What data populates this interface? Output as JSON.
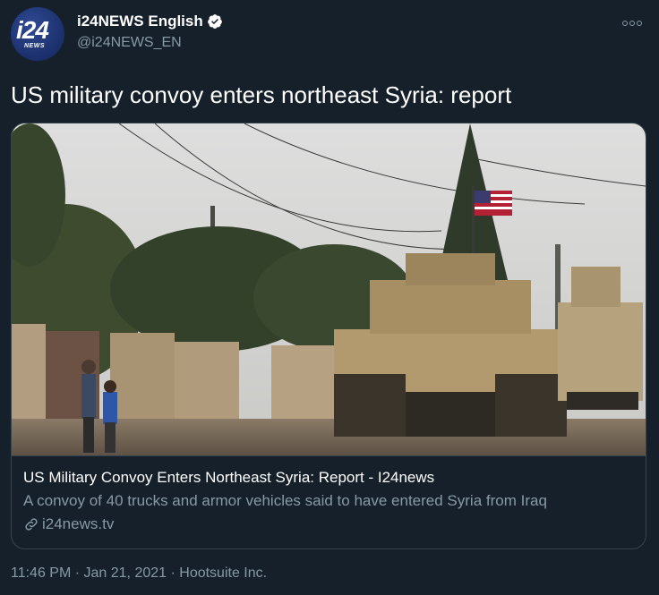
{
  "account": {
    "display_name": "i24NEWS English",
    "handle": "@i24NEWS_EN",
    "avatar_logo": "i24",
    "avatar_logo_sub": "NEWS"
  },
  "tweet": {
    "text": "US military convoy enters northeast Syria: report",
    "timestamp": "11:46 PM · Jan 21, 2021 · Hootsuite Inc."
  },
  "card": {
    "title": "US Military Convoy Enters Northeast Syria: Report - I24news",
    "description": "A convoy of 40 trucks and armor vehicles said to have entered Syria from Iraq",
    "domain": "i24news.tv"
  },
  "icons": {
    "verified": "verified-badge-icon",
    "more": "more-options-icon",
    "link": "link-icon"
  },
  "colors": {
    "background": "#15202b",
    "secondary_text": "#8899a6",
    "border": "#38444d"
  }
}
